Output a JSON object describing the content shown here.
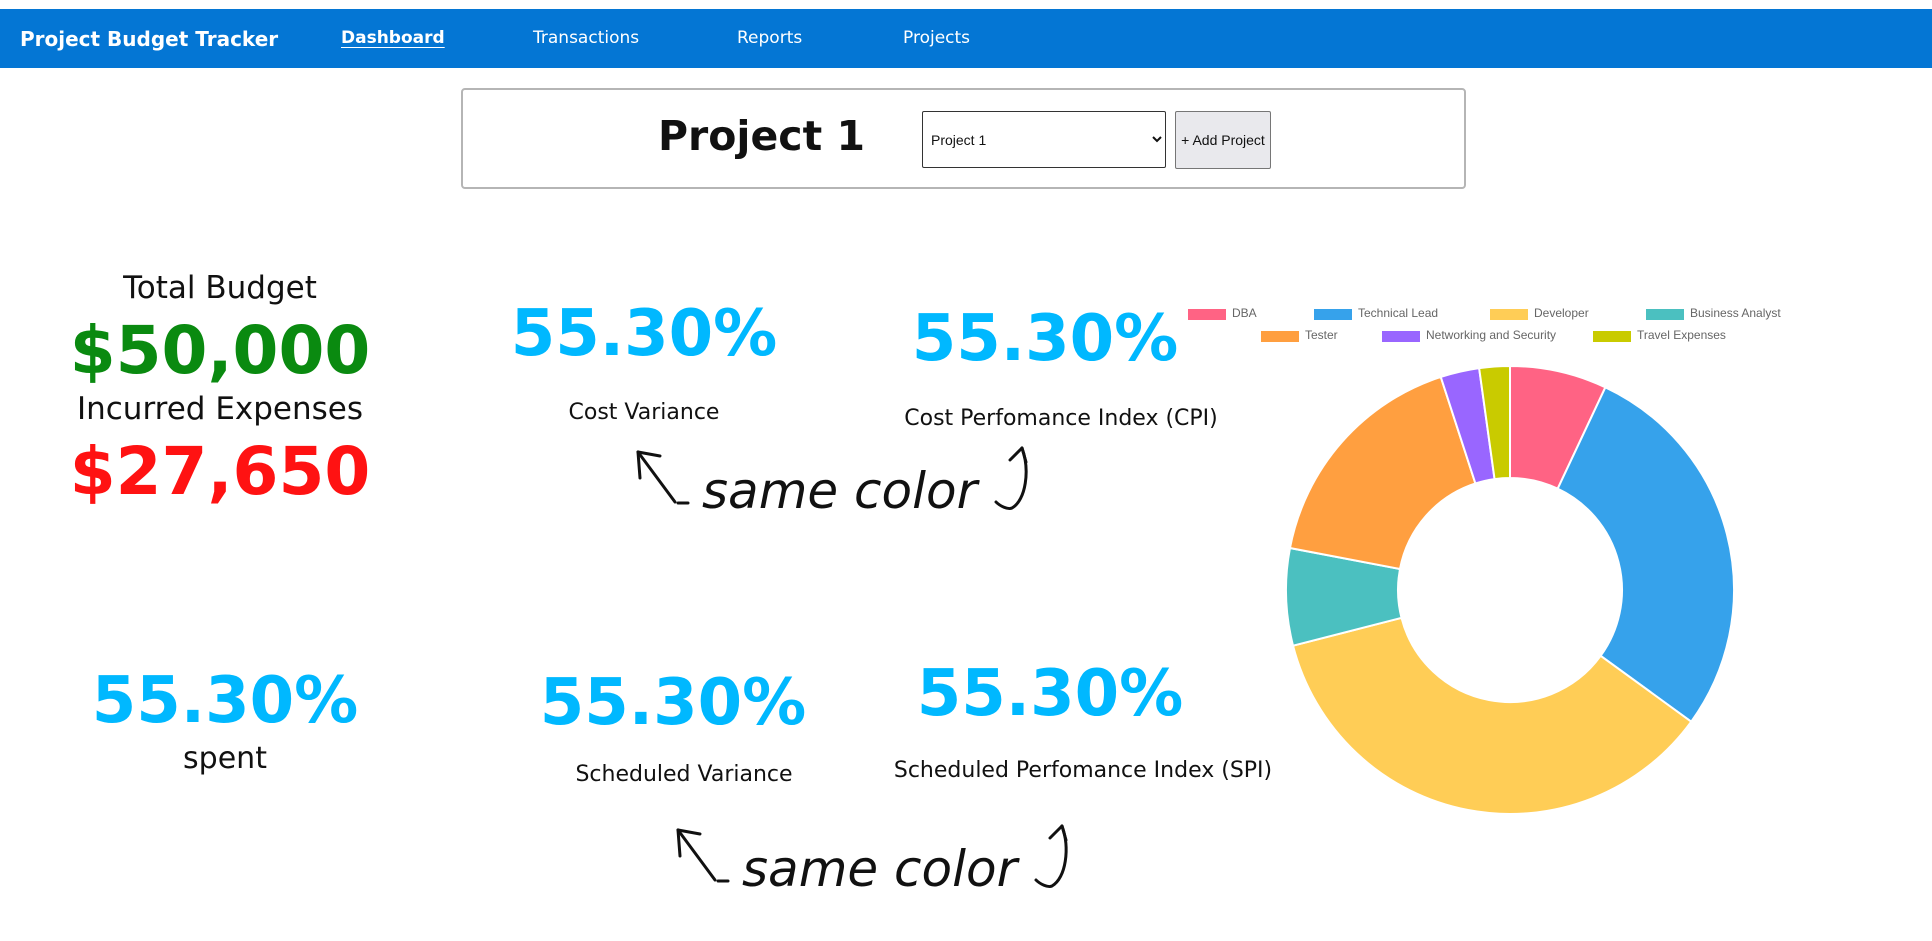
{
  "app": {
    "title": "Project Budget Tracker"
  },
  "nav": [
    {
      "label": "Dashboard",
      "active": true
    },
    {
      "label": "Transactions",
      "active": false
    },
    {
      "label": "Reports",
      "active": false
    },
    {
      "label": "Projects",
      "active": false
    }
  ],
  "project": {
    "title": "Project 1",
    "selected": "Project 1",
    "add_label": "+ Add Project"
  },
  "summary": {
    "total_budget_label": "Total Budget",
    "total_budget_value": "$50,000",
    "incurred_label": "Incurred Expenses",
    "incurred_value": "$27,650",
    "spent_value": "55.30%",
    "spent_label": "spent"
  },
  "metrics": {
    "cost_variance_value": "55.30%",
    "cost_variance_label": "Cost Variance",
    "cpi_value": "55.30%",
    "cpi_label": "Cost Perfomance Index (CPI)",
    "schedule_variance_value": "55.30%",
    "schedule_variance_label": "Scheduled Variance",
    "spi_value": "55.30%",
    "spi_label": "Scheduled Perfomance Index (SPI)"
  },
  "annotations": {
    "top": "same color",
    "bottom": "same color"
  },
  "colors": {
    "nav": "#0476d4",
    "accent": "#00b8ff",
    "budget": "#0a8a10",
    "expense": "#ff1212"
  },
  "chart_data": {
    "type": "pie",
    "donut": true,
    "legend": "top",
    "series": [
      {
        "name": "DBA",
        "value": 7.0,
        "color": "#ff6384"
      },
      {
        "name": "Technical Lead",
        "value": 28.0,
        "color": "#36a2eb"
      },
      {
        "name": "Developer",
        "value": 36.0,
        "color": "#ffcd56"
      },
      {
        "name": "Business Analyst",
        "value": 7.0,
        "color": "#4bc0c0"
      },
      {
        "name": "Tester",
        "value": 17.0,
        "color": "#ff9f40"
      },
      {
        "name": "Networking and Security",
        "value": 2.8,
        "color": "#9966ff"
      },
      {
        "name": "Travel Expenses",
        "value": 2.2,
        "color": "#c9cb00"
      }
    ]
  }
}
